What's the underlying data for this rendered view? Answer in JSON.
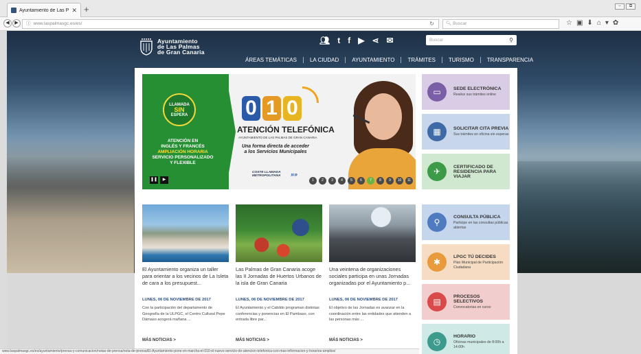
{
  "browser": {
    "tab_title": "Ayuntamiento de Las Palmas",
    "url": "www.laspalmasgc.es/es/",
    "search_placeholder": "Buscar"
  },
  "site": {
    "logo_lines": [
      "Ayuntamiento",
      "de Las Palmas",
      "de Gran Canaria"
    ],
    "search_placeholder": "Buscar",
    "nav": [
      "ÁREAS TEMÁTICAS",
      "LA CIUDAD",
      "AYUNTAMIENTO",
      "TRÁMITES",
      "TURISMO",
      "TRANSPARENCIA"
    ]
  },
  "banner": {
    "badge": [
      "LLAMADA",
      "SIN",
      "ESPERA"
    ],
    "side_lines": [
      "ATENCIÓN EN",
      "INGLÉS Y FRANCÉS",
      "AMPLIACIÓN HORARIA",
      "SERVICIO PERSONALIZADO",
      "Y FLEXIBLE"
    ],
    "number_digits": [
      "0",
      "1",
      "0"
    ],
    "title": "ATENCIÓN TELEFÓNICA",
    "subtitle": "AYUNTAMIENTO DE LAS PALMAS DE GRAN CANARIA",
    "slogan": "Una forma directa de acceder a los Servicios Municipales",
    "coste": [
      "COSTE LLAMADA",
      "METROPOLITANA"
    ],
    "slides": [
      "1",
      "2",
      "3",
      "4",
      "5",
      "6",
      "7",
      "8",
      "9",
      "10",
      "11"
    ],
    "active_slide": 7
  },
  "tiles": [
    {
      "title": "SEDE ELECTRÓNICA",
      "sub": "Realice sus trámites online",
      "color": "#d9cde6",
      "icon_color": "#7a5ea6"
    },
    {
      "title": "SOLICITAR CITA PREVIA",
      "sub": "Sus trámites en oficina sin esperas",
      "color": "#c7d6ea",
      "icon_color": "#3f6aa8"
    },
    {
      "title": "CERTIFICADO DE RESIDENCIA PARA VIAJAR",
      "sub": "",
      "color": "#cfe8cf",
      "icon_color": "#3d9a47"
    },
    {
      "title": "CONSULTA PÚBLICA",
      "sub": "Participe en las consultas públicas abiertas",
      "color": "#c5d5ec",
      "icon_color": "#4f7bc0"
    },
    {
      "title": "LPGC TÚ DECIDES",
      "sub": "Plan Municipal de Participación Ciudadana",
      "color": "#f5dcc2",
      "icon_color": "#e89a3c"
    },
    {
      "title": "PROCESOS SELECTIVOS",
      "sub": "Convocatorias en curso",
      "color": "#f2cdcd",
      "icon_color": "#d94a4a"
    },
    {
      "title": "HORARIO",
      "sub": "Oficinas municipales de 8:00h a 14:00h",
      "color": "#cfeae6",
      "icon_color": "#3d9b8d"
    }
  ],
  "news": [
    {
      "headline": "El Ayuntamiento organiza un taller para orientar a los vecinos de La Isleta de cara a los presupuest...",
      "date": "LUNES, 06 DE NOVIEMBRE DE 2017",
      "body": "Con la participación del departamento de Geografía de la ULPGC, el Centro Cultural Pepe Dámaso acogerá mañana ...",
      "more": "MÁS NOTICIAS >"
    },
    {
      "headline": "Las Palmas de Gran Canaria acoge las II Jornadas de Huertos Urbanos de la isla de Gran Canaria",
      "date": "LUNES, 06 DE NOVIEMBRE DE 2017",
      "body": "El Ayuntamiento y el Cabildo programan distintas conferencias y ponencias en El Pambaso, con entrada libre par...",
      "more": "MÁS NOTICIAS >"
    },
    {
      "headline": "Una veintena de organizaciones sociales participa en unas Jornadas organizadas por el Ayuntamiento p...",
      "date": "LUNES, 06 DE NOVIEMBRE DE 2017",
      "body": "El objetivo de las Jornadas es avanzar en la coordinación entre las entidades que atienden a las personas más ...",
      "more": "MÁS NOTICIAS >"
    }
  ],
  "status_url": "www.laspalmasgc.es/es/ayuntamiento/prensa-y-comunicacion/notas-de-prensa/nota-de-prensa/El-Ayuntamiento-pone-en-marcha-el-010-el-nuevo-servicio-de-atencion-telefonica-con-mas-informacion-y-horarios-amplios/"
}
